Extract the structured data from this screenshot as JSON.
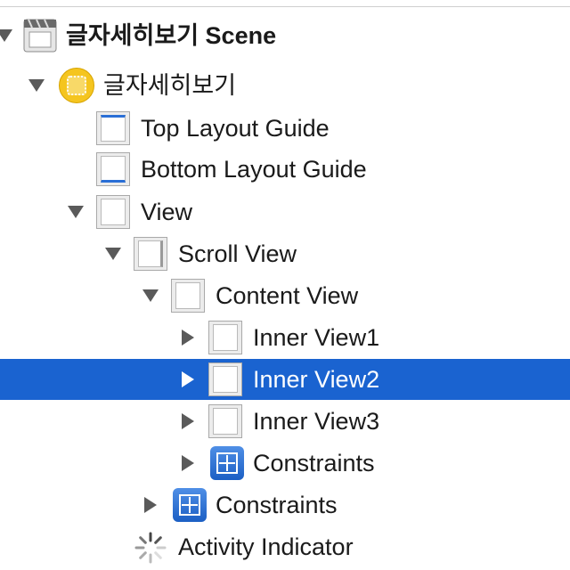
{
  "tree": {
    "scene": {
      "label": "글자세히보기 Scene",
      "icon": "scene-clapper-icon"
    },
    "controller": {
      "label": "글자세히보기",
      "icon": "view-controller-icon"
    },
    "top_guide": {
      "label": "Top Layout Guide",
      "icon": "layout-guide-icon"
    },
    "bottom_guide": {
      "label": "Bottom Layout Guide",
      "icon": "layout-guide-icon"
    },
    "view": {
      "label": "View",
      "icon": "view-icon"
    },
    "scroll_view": {
      "label": "Scroll View",
      "icon": "scroll-view-icon"
    },
    "content_view": {
      "label": "Content View",
      "icon": "view-icon"
    },
    "inner_view1": {
      "label": "Inner View1",
      "icon": "view-icon"
    },
    "inner_view2": {
      "label": "Inner View2",
      "icon": "view-icon",
      "selected": true
    },
    "inner_view3": {
      "label": "Inner View3",
      "icon": "view-icon"
    },
    "inner_constraints": {
      "label": "Constraints",
      "icon": "constraints-icon"
    },
    "content_constraints": {
      "label": "Constraints",
      "icon": "constraints-icon"
    },
    "activity_indicator": {
      "label": "Activity Indicator",
      "icon": "activity-indicator-icon"
    }
  },
  "colors": {
    "selection": "#1a63d0",
    "constraint_icon": "#2a6fd6",
    "controller_icon": "#f5c51f"
  }
}
